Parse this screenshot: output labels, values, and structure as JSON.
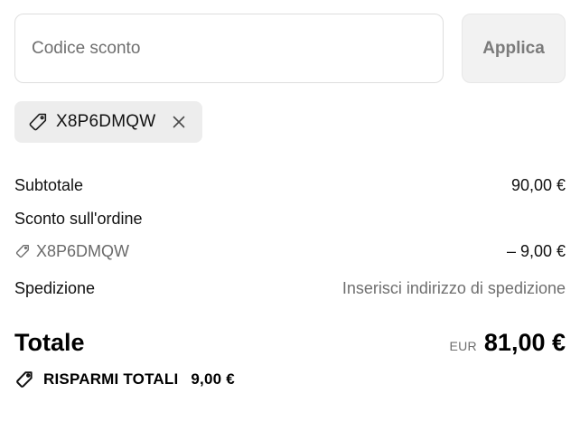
{
  "discount": {
    "placeholder": "Codice sconto",
    "apply_label": "Applica"
  },
  "applied_code": {
    "code": "X8P6DMQW"
  },
  "summary": {
    "subtotal_label": "Subtotale",
    "subtotal_value": "90,00 €",
    "order_discount_label": "Sconto sull'ordine",
    "order_discount_code": "X8P6DMQW",
    "order_discount_value": "– 9,00 €",
    "shipping_label": "Spedizione",
    "shipping_value": "Inserisci indirizzo di spedizione"
  },
  "total": {
    "label": "Totale",
    "currency": "EUR",
    "value": "81,00 €"
  },
  "savings": {
    "label": "RISPARMI TOTALI",
    "value": "9,00 €"
  },
  "icons": {
    "tag": "tag-icon",
    "close": "close-icon",
    "savings": "savings-tag-icon"
  },
  "colors": {
    "chip_bg": "#ededed",
    "button_bg": "#f2f2f2",
    "muted_text": "#6f6f6f"
  }
}
